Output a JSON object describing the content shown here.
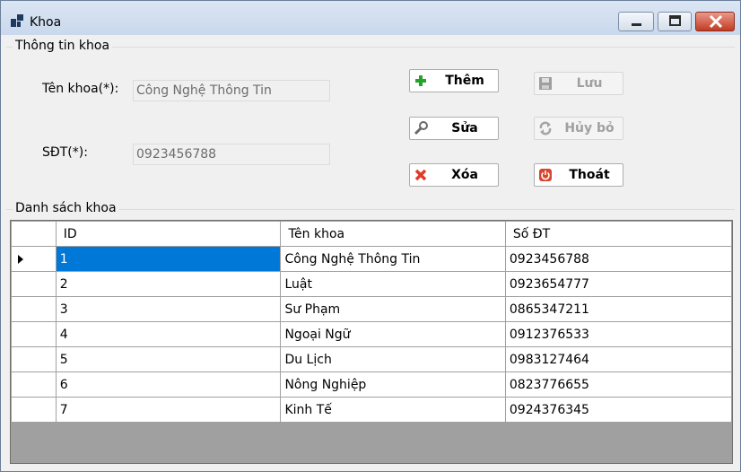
{
  "window": {
    "title": "Khoa"
  },
  "info_group": {
    "title": "Thông tin khoa",
    "name_label": "Tên khoa(*):",
    "name_value": "Công Nghệ Thông Tin",
    "phone_label": "SĐT(*):",
    "phone_value": "0923456788"
  },
  "buttons": {
    "add": "Thêm",
    "save": "Lưu",
    "edit": "Sửa",
    "cancel": "Hủy bỏ",
    "delete": "Xóa",
    "exit": "Thoát"
  },
  "list_group": {
    "title": "Danh sách khoa"
  },
  "table": {
    "columns": [
      "ID",
      "Tên khoa",
      "Số ĐT"
    ],
    "rows": [
      [
        "1",
        "Công Nghệ Thông Tin",
        "0923456788"
      ],
      [
        "2",
        "Luật",
        "0923654777"
      ],
      [
        "3",
        "Sư Phạm",
        "0865347211"
      ],
      [
        "4",
        "Ngoại Ngữ",
        "0912376533"
      ],
      [
        "5",
        "Du Lịch",
        "0983127464"
      ],
      [
        "6",
        "Nông Nghiệp",
        "0823776655"
      ],
      [
        "7",
        "Kinh Tế",
        "0924376345"
      ]
    ]
  },
  "icons": {
    "window": "app-window-icon",
    "add": "plus-icon",
    "save": "floppy-disk-icon",
    "edit": "wrench-icon",
    "cancel": "refresh-icon",
    "delete": "red-x-icon",
    "exit": "power-icon"
  },
  "colors": {
    "selection": "#0078d7",
    "close_button": "#c43b22"
  }
}
